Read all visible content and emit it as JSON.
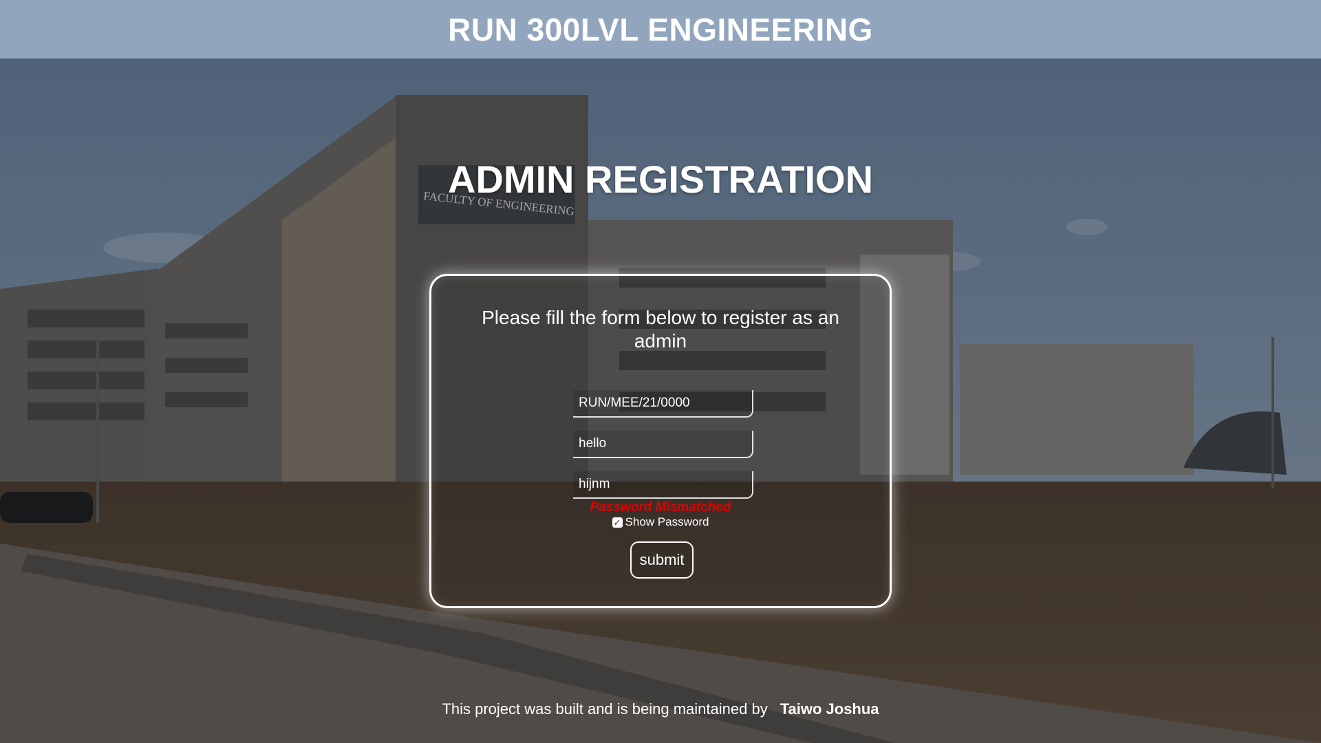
{
  "header": {
    "title": "RUN 300LVL ENGINEERING"
  },
  "page_title": "ADMIN REGISTRATION",
  "form": {
    "instructions": "Please fill the form below to register as an admin",
    "fields": [
      {
        "name": "matric-number",
        "value": "RUN/MEE/21/0000"
      },
      {
        "name": "password",
        "value": "hello"
      },
      {
        "name": "confirm-password",
        "value": "hijnm"
      }
    ],
    "error_message": "Password Mismatched",
    "show_password_label": "Show Password",
    "show_password_checked": true,
    "submit_label": "submit"
  },
  "background_building_sign": "FACULTY OF ENGINEERING",
  "footer": {
    "text": "This project was built and is being maintained by",
    "author": "Taiwo Joshua"
  },
  "colors": {
    "header_bg": "#a0b4cd",
    "error": "#e00000",
    "text": "#ffffff"
  }
}
